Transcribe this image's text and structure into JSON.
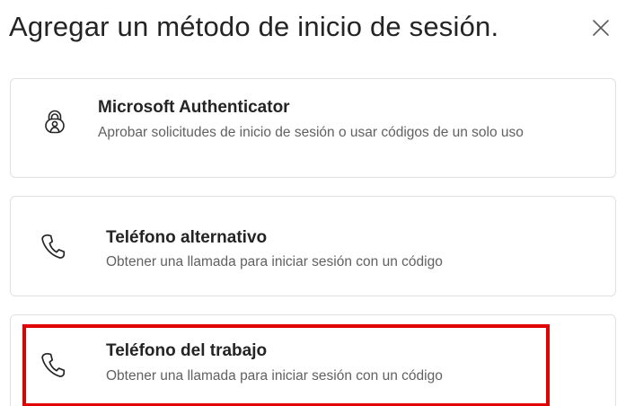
{
  "dialog": {
    "title": "Agregar un método de inicio de sesión.",
    "close_icon": "close-icon"
  },
  "options": [
    {
      "icon": "authenticator-icon",
      "title": "Microsoft Authenticator",
      "description": "Aprobar solicitudes de inicio de sesión o usar códigos de un solo uso"
    },
    {
      "icon": "phone-icon",
      "title": "Teléfono alternativo",
      "description": "Obtener una llamada para iniciar sesión con un código"
    },
    {
      "icon": "phone-icon",
      "title": "Teléfono del trabajo",
      "description": "Obtener una llamada para iniciar sesión con un código"
    }
  ],
  "colors": {
    "highlight": "#e00000",
    "text": "#242424",
    "secondary_text": "#616161",
    "border": "#e1e1e1"
  }
}
